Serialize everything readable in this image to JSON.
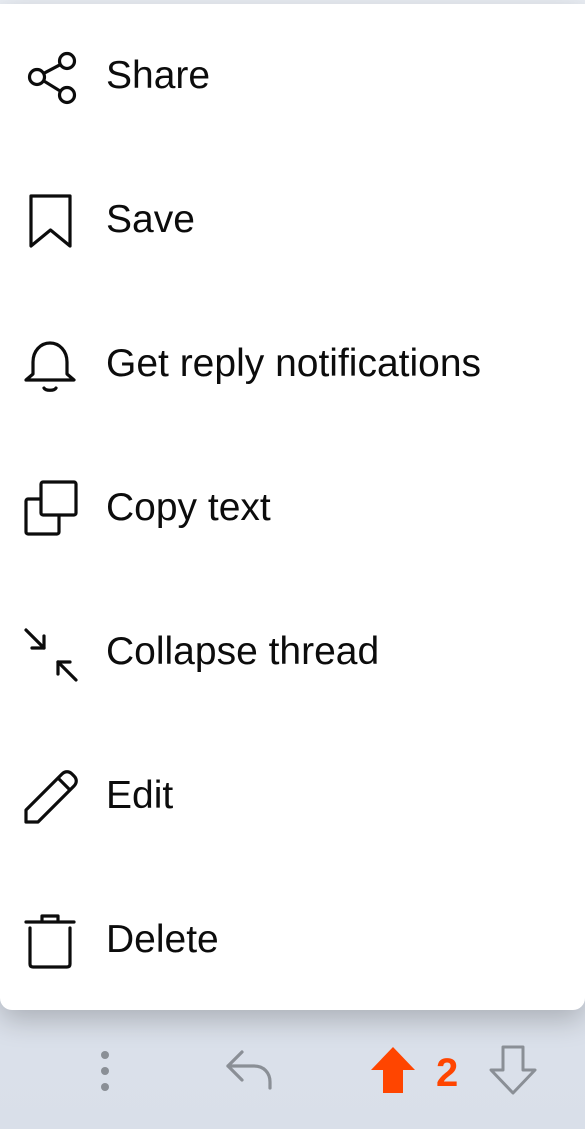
{
  "menu": {
    "items": [
      {
        "label": "Share",
        "icon": "share-icon"
      },
      {
        "label": "Save",
        "icon": "bookmark-icon"
      },
      {
        "label": "Get reply notifications",
        "icon": "bell-icon"
      },
      {
        "label": "Copy text",
        "icon": "copy-icon"
      },
      {
        "label": "Collapse thread",
        "icon": "collapse-icon"
      },
      {
        "label": "Edit",
        "icon": "pencil-icon"
      },
      {
        "label": "Delete",
        "icon": "trash-icon"
      }
    ]
  },
  "action_bar": {
    "more_icon": "more-vertical-icon",
    "reply_icon": "reply-icon",
    "upvote_icon": "upvote-arrow-icon",
    "downvote_icon": "downvote-arrow-icon",
    "score": "2",
    "upvote_state": "upvoted"
  },
  "colors": {
    "upvote_accent": "#ff4500",
    "menu_background": "#ffffff",
    "page_background": "#dfe4ed",
    "muted_icon": "#8a8f96",
    "text": "#0c0c0c"
  }
}
